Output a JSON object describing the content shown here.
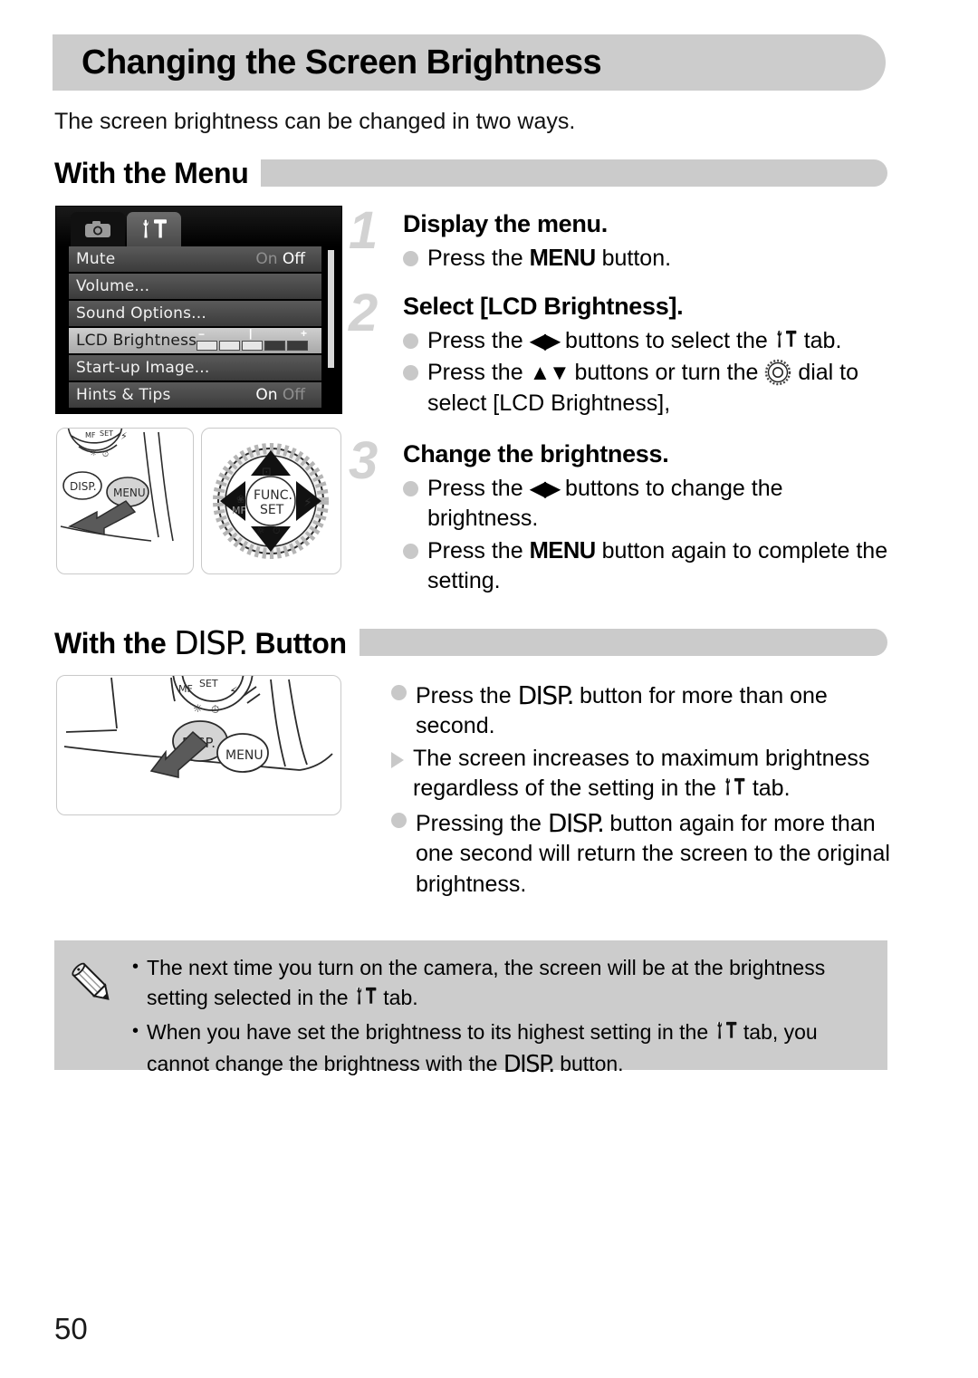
{
  "page": {
    "title": "Changing the Screen Brightness",
    "intro": "The screen brightness can be changed in two ways.",
    "page_number": "50"
  },
  "sections": {
    "menu": {
      "heading_prefix": "With the Menu",
      "heading_suffix": ""
    },
    "disp": {
      "heading_prefix": "With the ",
      "heading_icon": "DISP.",
      "heading_suffix": " Button"
    }
  },
  "lcd_screen": {
    "tabs": [
      {
        "name": "camera-tab",
        "icon": "camera-icon",
        "active": false
      },
      {
        "name": "tools-tab",
        "icon": "wrench-hammer-icon",
        "active": true
      }
    ],
    "rows": [
      {
        "label": "Mute",
        "value_on": "On",
        "value_off": "Off",
        "active_value": "Off",
        "selected": false
      },
      {
        "label": "Volume...",
        "value_on": "",
        "value_off": "",
        "active_value": "",
        "selected": false
      },
      {
        "label": "Sound Options...",
        "value_on": "",
        "value_off": "",
        "active_value": "",
        "selected": false
      },
      {
        "label": "LCD Brightness",
        "value_on": "",
        "value_off": "",
        "active_value": "",
        "selected": true
      },
      {
        "label": "Start-up Image...",
        "value_on": "",
        "value_off": "",
        "active_value": "",
        "selected": false
      },
      {
        "label": "Hints & Tips",
        "value_on": "On",
        "value_off": "Off",
        "active_value": "On",
        "selected": false
      }
    ],
    "brightness_slider": {
      "minus_label": "−",
      "mid_label": "|",
      "plus_label": "+",
      "total_segments": 5,
      "filled_segments": 3
    }
  },
  "illustrations": [
    {
      "name": "menu-button-illustration",
      "buttons": [
        "DISP.",
        "MENU"
      ],
      "highlighted": "MENU"
    },
    {
      "name": "control-dial-illustration",
      "center_label_top": "FUNC.",
      "center_label_bottom": "SET"
    },
    {
      "name": "disp-button-illustration",
      "buttons": [
        "DISP.",
        "MENU"
      ],
      "highlighted": "DISP."
    }
  ],
  "steps": [
    {
      "number": "1",
      "title": "Display the menu.",
      "bullets": [
        {
          "marker": "dot",
          "parts": [
            {
              "t": "text",
              "v": "Press the "
            },
            {
              "t": "menu",
              "v": "MENU"
            },
            {
              "t": "text",
              "v": " button."
            }
          ]
        }
      ]
    },
    {
      "number": "2",
      "title": "Select [LCD Brightness].",
      "bullets": [
        {
          "marker": "dot",
          "parts": [
            {
              "t": "text",
              "v": "Press the "
            },
            {
              "t": "keys",
              "v": "◀▶"
            },
            {
              "t": "text",
              "v": " buttons to select the "
            },
            {
              "t": "tabicon",
              "v": "tools-tab-icon"
            },
            {
              "t": "text",
              "v": " tab."
            }
          ]
        },
        {
          "marker": "dot",
          "parts": [
            {
              "t": "text",
              "v": "Press the "
            },
            {
              "t": "keys",
              "v": "▲▼"
            },
            {
              "t": "text",
              "v": " buttons or turn the "
            },
            {
              "t": "dialicon",
              "v": "control-dial-icon"
            },
            {
              "t": "text",
              "v": " dial to select [LCD Brightness],"
            }
          ]
        }
      ]
    },
    {
      "number": "3",
      "title": "Change the brightness.",
      "bullets": [
        {
          "marker": "dot",
          "parts": [
            {
              "t": "text",
              "v": "Press the "
            },
            {
              "t": "keys",
              "v": "◀▶"
            },
            {
              "t": "text",
              "v": " buttons to change the brightness."
            }
          ]
        },
        {
          "marker": "dot",
          "parts": [
            {
              "t": "text",
              "v": "Press the "
            },
            {
              "t": "menu",
              "v": "MENU"
            },
            {
              "t": "text",
              "v": " button again to complete the setting."
            }
          ]
        }
      ]
    }
  ],
  "disp_bullets": [
    {
      "marker": "dot",
      "parts": [
        {
          "t": "text",
          "v": "Press the "
        },
        {
          "t": "disp",
          "v": "DISP."
        },
        {
          "t": "text",
          "v": " button for more than one second."
        }
      ]
    },
    {
      "marker": "triangle",
      "parts": [
        {
          "t": "text",
          "v": "The screen increases to maximum brightness regardless of the setting in the "
        },
        {
          "t": "tabicon",
          "v": "tools-tab-icon"
        },
        {
          "t": "text",
          "v": " tab."
        }
      ]
    },
    {
      "marker": "dot",
      "parts": [
        {
          "t": "text",
          "v": "Pressing the "
        },
        {
          "t": "disp",
          "v": "DISP."
        },
        {
          "t": "text",
          "v": " button again for more than one second will return the screen to the original brightness."
        }
      ]
    }
  ],
  "note_box": {
    "icon": "pencil-icon",
    "bullet_char": "•",
    "items": [
      {
        "parts": [
          {
            "t": "text",
            "v": "The next time you turn on the camera, the screen will be at the brightness setting selected in the "
          },
          {
            "t": "tabicon",
            "v": "tools-tab-icon"
          },
          {
            "t": "text",
            "v": " tab."
          }
        ]
      },
      {
        "parts": [
          {
            "t": "text",
            "v": "When you have set the brightness to its highest setting in the "
          },
          {
            "t": "tabicon",
            "v": "tools-tab-icon"
          },
          {
            "t": "text",
            "v": " tab, you cannot change the brightness with the "
          },
          {
            "t": "disp",
            "v": "DISP."
          },
          {
            "t": "text",
            "v": " button."
          }
        ]
      }
    ]
  },
  "colors": {
    "header_bar": "#cccccc",
    "section_bar": "#cbcbcb",
    "step_number": "#d2d2d2",
    "bullet_marker": "#c8c8c8",
    "note_bg": "#cccccc"
  }
}
